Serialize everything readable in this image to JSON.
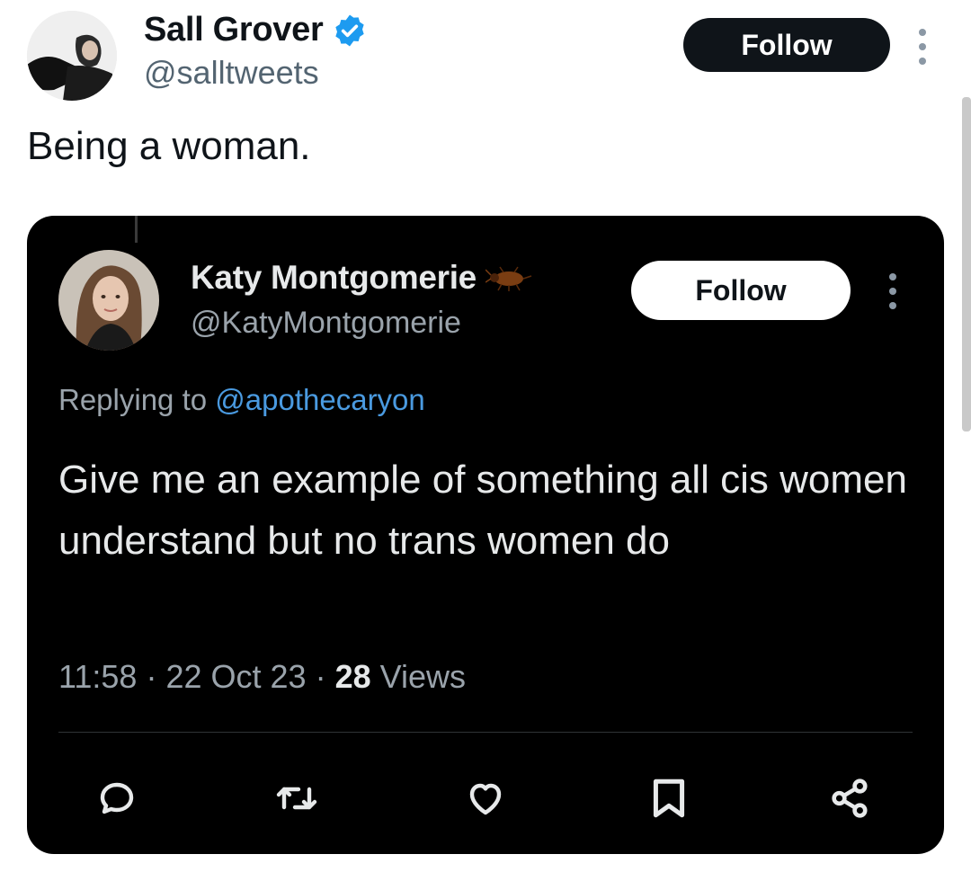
{
  "tweet": {
    "author_name": "Sall Grover",
    "author_handle": "@salltweets",
    "follow_label": "Follow",
    "text": "Being a woman."
  },
  "quoted": {
    "author_name": "Katy Montgomerie",
    "author_handle": "@KatyMontgomerie",
    "follow_label": "Follow",
    "replying_prefix": "Replying to",
    "replying_mention": "@apothecaryon",
    "text": "Give me an example of something all cis women understand but no trans women do",
    "time": "11:58",
    "sep1": "·",
    "date": "22 Oct 23",
    "sep2": "·",
    "views_count": "28",
    "views_label": "Views",
    "actions": [
      "reply-icon",
      "retweet-icon",
      "like-icon",
      "bookmark-icon",
      "share-icon"
    ]
  },
  "colors": {
    "verified_blue": "#1d9bf0",
    "mention_blue": "#4a9ae0",
    "card_bg": "#000000",
    "dark_button": "#0f1419"
  }
}
